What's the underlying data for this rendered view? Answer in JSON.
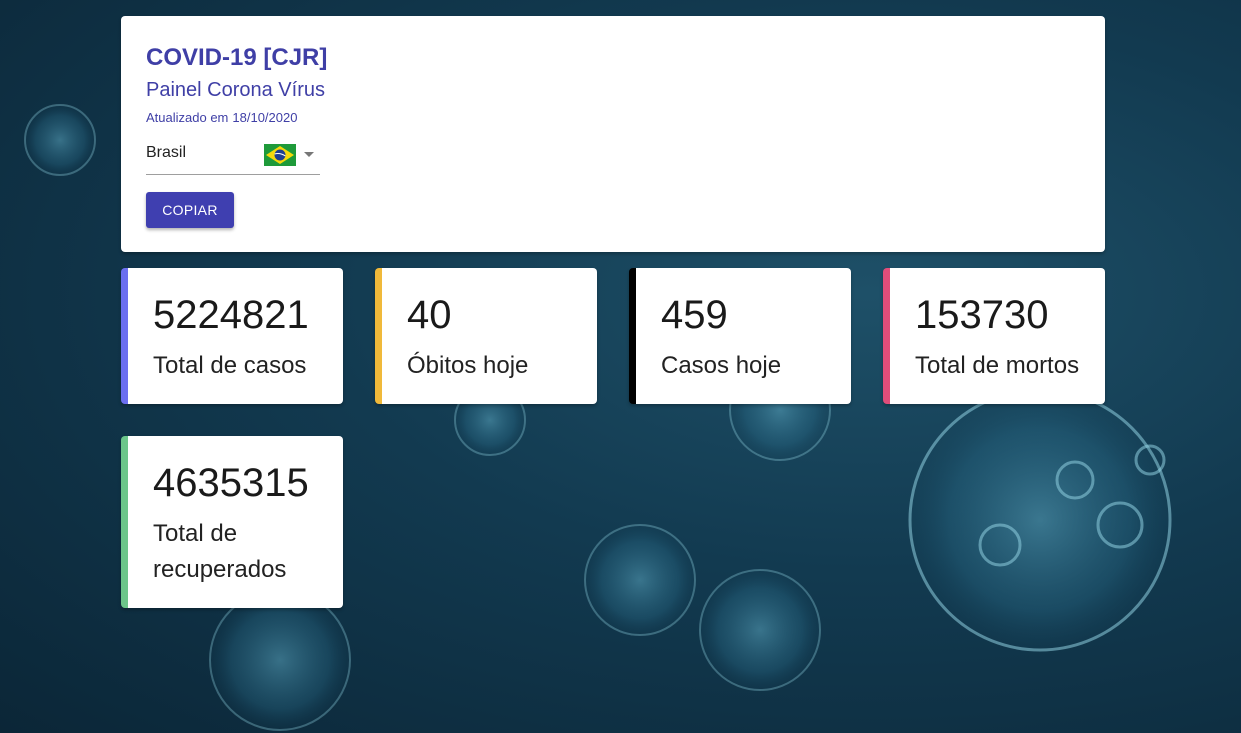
{
  "header": {
    "title": "COVID-19 [CJR]",
    "subtitle": "Painel Corona Vírus",
    "updated_label": "Atualizado em",
    "updated_date": "18/10/2020",
    "country_select": {
      "value": "Brasil",
      "flag_icon": "brazil-flag-icon"
    },
    "copy_button": "COPIAR"
  },
  "stats": [
    {
      "value": "5224821",
      "label": "Total de casos",
      "color": "#6b6ff0"
    },
    {
      "value": "40",
      "label": "Óbitos hoje",
      "color": "#f0b93a"
    },
    {
      "value": "459",
      "label": "Casos hoje",
      "color": "#000000"
    },
    {
      "value": "153730",
      "label": "Total de mortos",
      "color": "#e04d7a"
    },
    {
      "value": "4635315",
      "label": "Total de recuperados",
      "color": "#6cc68a"
    }
  ],
  "colors": {
    "accent": "#3f3fa6",
    "button": "#3f3fb0"
  }
}
